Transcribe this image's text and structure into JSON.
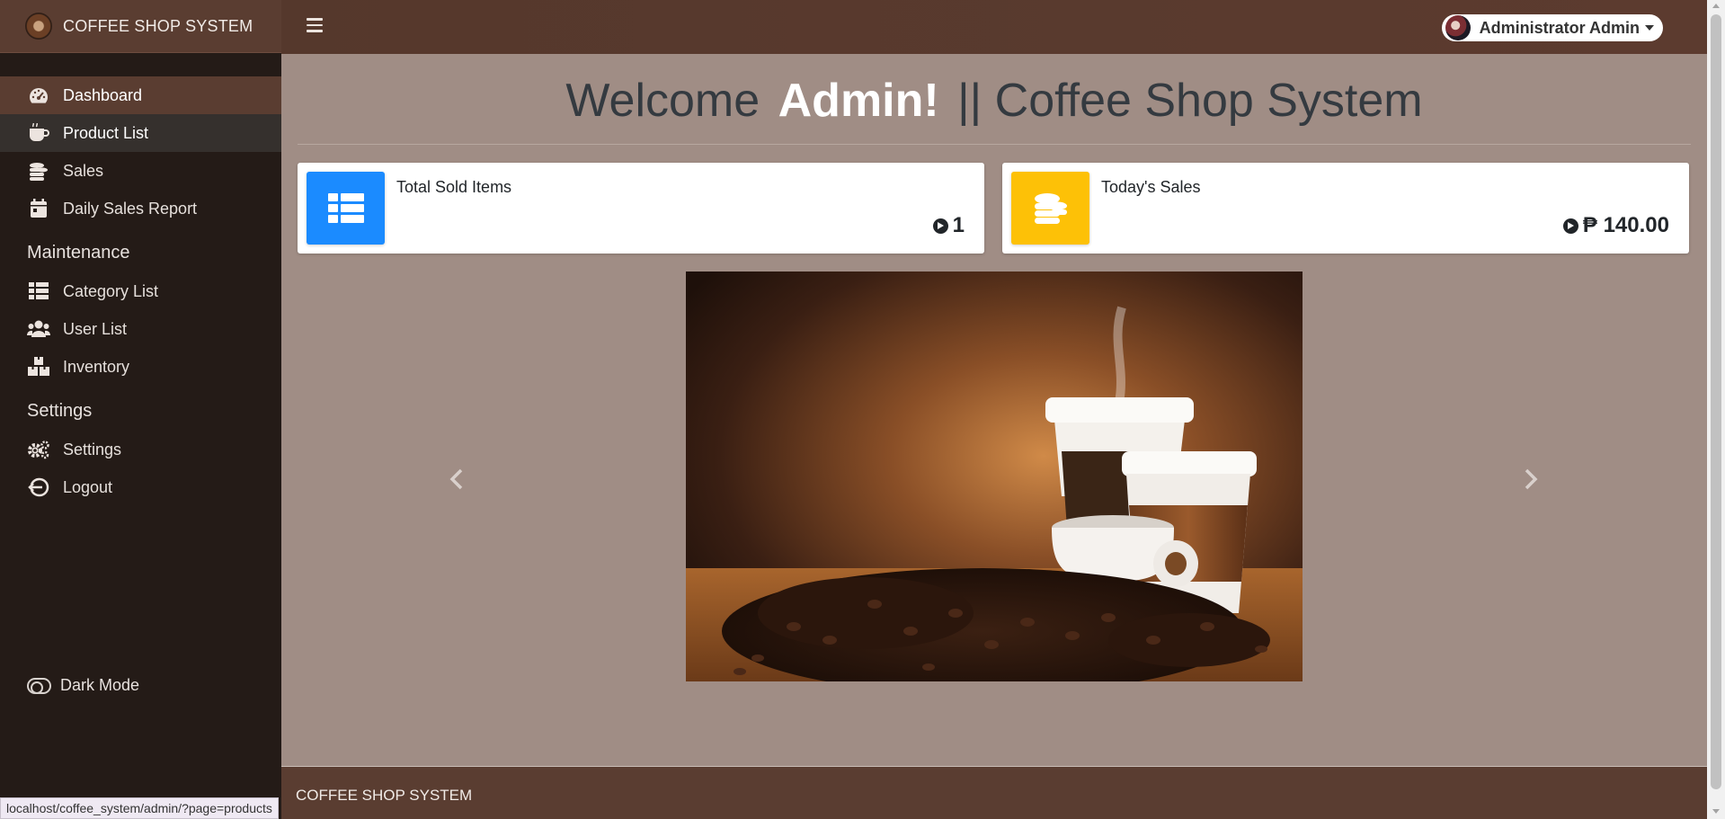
{
  "brand": {
    "name": "COFFEE SHOP SYSTEM"
  },
  "topbar": {
    "user_name": "Administrator Admin"
  },
  "sidebar": {
    "items": [
      {
        "label": "Dashboard",
        "icon": "tachometer-icon"
      },
      {
        "label": "Product List",
        "icon": "coffee-cup-icon"
      },
      {
        "label": "Sales",
        "icon": "coins-icon"
      },
      {
        "label": "Daily Sales Report",
        "icon": "calendar-icon"
      }
    ],
    "maintenance_header": "Maintenance",
    "maintenance_items": [
      {
        "label": "Category List",
        "icon": "th-list-icon"
      },
      {
        "label": "User List",
        "icon": "users-icon"
      },
      {
        "label": "Inventory",
        "icon": "boxes-icon"
      }
    ],
    "settings_header": "Settings",
    "settings_items": [
      {
        "label": "Settings",
        "icon": "cogs-icon"
      },
      {
        "label": "Logout",
        "icon": "logout-icon"
      }
    ],
    "dark_mode_label": "Dark Mode"
  },
  "main": {
    "title_welcome": "Welcome",
    "title_admin": "Admin!",
    "title_rest": "|| Coffee Shop System",
    "cards": [
      {
        "label": "Total Sold Items",
        "value": "1",
        "icon": "th-list-icon",
        "color": "#1b8bff"
      },
      {
        "label": "Today's Sales",
        "value": "₱ 140.00",
        "icon": "coins-icon",
        "color": "#fdc107"
      }
    ]
  },
  "footer": {
    "text": "COFFEE SHOP SYSTEM"
  },
  "status_bar": {
    "url": "localhost/coffee_system/admin/?page=products"
  }
}
